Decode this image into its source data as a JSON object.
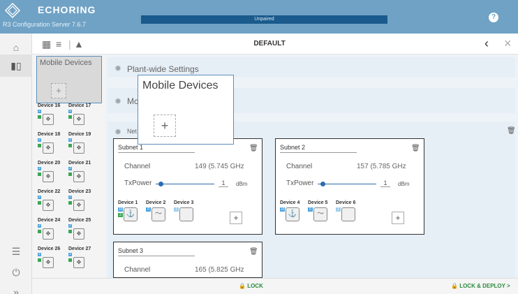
{
  "header": {
    "brand": "ECHORING",
    "subbrand": "R3 Configuration Server 7.6.7",
    "status": "Unpaired",
    "help_icon": "?"
  },
  "toolbar": {
    "title": "DEFAULT",
    "back_icon": "chevron-left-icon",
    "close_icon": "close-icon"
  },
  "device_panel": {
    "title": "Mobile Devices",
    "add_label": "+",
    "devices": [
      {
        "label": "Device 16",
        "badge": "2"
      },
      {
        "label": "Device 17",
        "badge": "2"
      },
      {
        "label": "Device 18",
        "badge": "2"
      },
      {
        "label": "Device 19",
        "badge": "2"
      },
      {
        "label": "Device 20",
        "badge": "2"
      },
      {
        "label": "Device 21",
        "badge": "2"
      },
      {
        "label": "Device 22",
        "badge": "2"
      },
      {
        "label": "Device 23",
        "badge": "2"
      },
      {
        "label": "Device 24",
        "badge": "2"
      },
      {
        "label": "Device 25",
        "badge": "2"
      },
      {
        "label": "Device 26",
        "badge": "2"
      },
      {
        "label": "Device 27",
        "badge": "2"
      }
    ]
  },
  "popup": {
    "title": "Mobile Devices",
    "add_label": "+"
  },
  "sections": {
    "plant_wide": "Plant-wide Settings",
    "mobile_partial": "Mc",
    "network_partial": "Net"
  },
  "subnets": [
    {
      "name": "Subnet 1",
      "channel_label": "Channel",
      "channel_value": "149 (5.745 GHz",
      "tx_label": "TxPower",
      "tx_value": "1",
      "tx_unit": "dBm",
      "devices": [
        "Device 1",
        "Device 2",
        "Device 3"
      ],
      "add_label": "+"
    },
    {
      "name": "Subnet 2",
      "channel_label": "Channel",
      "channel_value": "157 (5.785 GHz",
      "tx_label": "TxPower",
      "tx_value": "1",
      "tx_unit": "dBm",
      "devices": [
        "Device 4",
        "Device 5",
        "Device 6"
      ],
      "add_label": "+"
    },
    {
      "name": "Subnet 3",
      "channel_label": "Channel",
      "channel_value": "165 (5.825 GHz"
    }
  ],
  "bottom": {
    "lock": "LOCK",
    "lock_deploy": "LOCK & DEPLOY >"
  },
  "colors": {
    "header": "#6fa2c5",
    "status_bar": "#1a5a8c",
    "accent_green": "#2b8a3e"
  }
}
